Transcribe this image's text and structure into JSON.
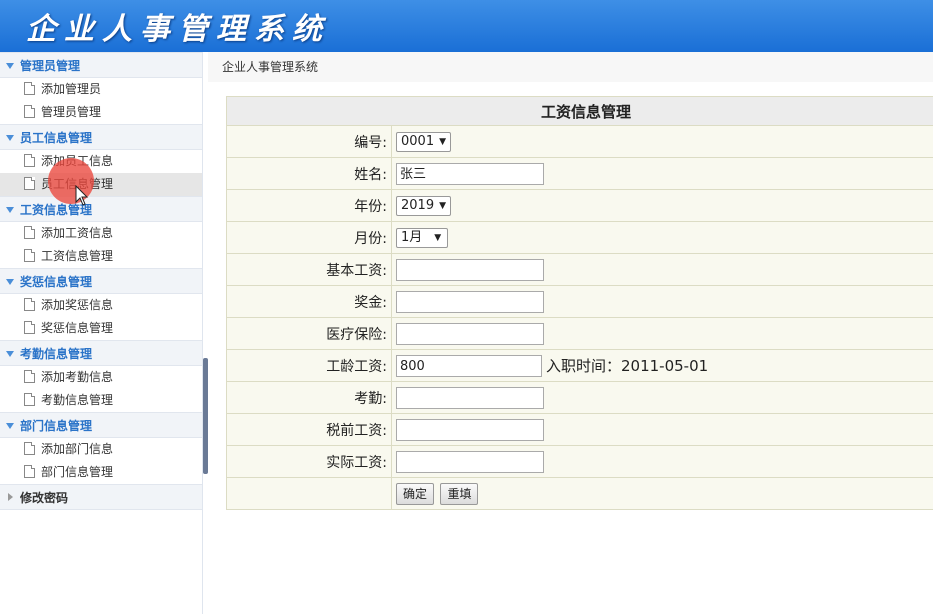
{
  "app_title": "企业人事管理系统",
  "breadcrumb": "企业人事管理系统",
  "sidebar": {
    "groups": [
      {
        "label": "管理员管理",
        "items": [
          "添加管理员",
          "管理员管理"
        ]
      },
      {
        "label": "员工信息管理",
        "items": [
          "添加员工信息",
          "员工信息管理"
        ]
      },
      {
        "label": "工资信息管理",
        "items": [
          "添加工资信息",
          "工资信息管理"
        ]
      },
      {
        "label": "奖惩信息管理",
        "items": [
          "添加奖惩信息",
          "奖惩信息管理"
        ]
      },
      {
        "label": "考勤信息管理",
        "items": [
          "添加考勤信息",
          "考勤信息管理"
        ]
      },
      {
        "label": "部门信息管理",
        "items": [
          "添加部门信息",
          "部门信息管理"
        ]
      },
      {
        "label": "修改密码",
        "items": []
      }
    ]
  },
  "form": {
    "title": "工资信息管理",
    "labels": {
      "id": "编号:",
      "name": "姓名:",
      "year": "年份:",
      "month": "月份:",
      "base_salary": "基本工资:",
      "bonus": "奖金:",
      "medical": "医疗保险:",
      "seniority": "工龄工资:",
      "attendance": "考勤:",
      "pretax": "税前工资:",
      "actual": "实际工资:"
    },
    "values": {
      "id": "0001",
      "name": "张三",
      "year": "2019",
      "month": "1月",
      "seniority": "800"
    },
    "hire_note": "入职时间：2011-05-01",
    "confirm_label": "确定",
    "reset_label": "重填"
  }
}
